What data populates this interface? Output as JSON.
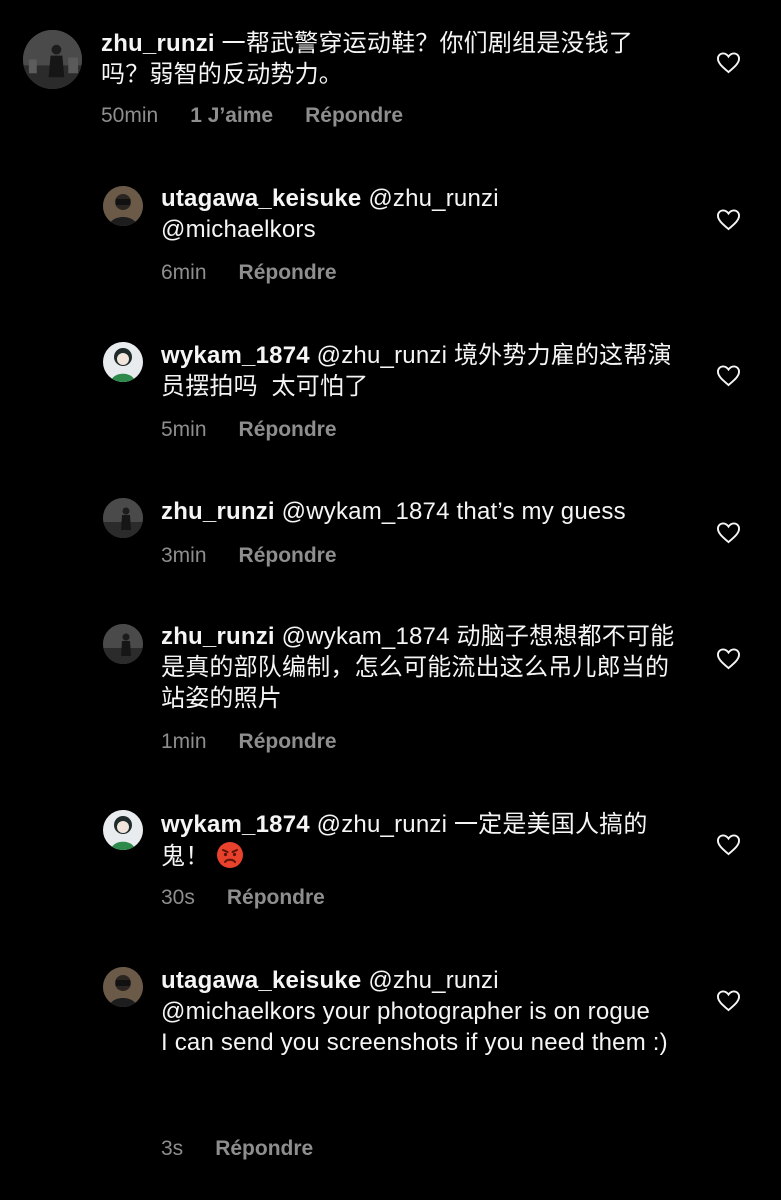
{
  "comments": [
    {
      "username": "zhu_runzi",
      "text": "一帮武警穿运动鞋？你们剧组是没钱了吗？弱智的反动势力。",
      "time": "50min",
      "likes": "1 J’aime",
      "reply_label": "Répondre"
    }
  ],
  "replies": [
    {
      "username": "utagawa_keisuke",
      "mention": "@zhu_runzi",
      "line2": "@michaelkors",
      "time": "6min",
      "reply_label": "Répondre"
    },
    {
      "username": "wykam_1874",
      "mention": "@zhu_runzi",
      "text": "境外势力雇的这帮演员摆拍吗  太可怕了",
      "time": "5min",
      "reply_label": "Répondre"
    },
    {
      "username": "zhu_runzi",
      "mention": "@wykam_1874",
      "text": "that’s my guess",
      "time": "3min",
      "reply_label": "Répondre"
    },
    {
      "username": "zhu_runzi",
      "mention": "@wykam_1874",
      "text": "动脑子想想都不可能是真的部队编制，怎么可能流出这么吊儿郎当的站姿的照片",
      "time": "1min",
      "reply_label": "Répondre"
    },
    {
      "username": "wykam_1874",
      "mention": "@zhu_runzi",
      "text": "一定是美国人搞的鬼！",
      "emoji": "angry-face-emoji",
      "time": "30s",
      "reply_label": "Répondre"
    },
    {
      "username": "utagawa_keisuke",
      "mention": "@zhu_runzi",
      "text": "@michaelkors your photographer is on rogue",
      "text2": "I can send you screenshots if you need them :)",
      "time": "3s",
      "reply_label": "Répondre"
    }
  ],
  "icons": {
    "like": "heart-outline-icon"
  },
  "colors": {
    "background": "#000000",
    "text": "#f5f5f5",
    "secondary": "#8e8e8e",
    "emoji": "#e8412c"
  }
}
